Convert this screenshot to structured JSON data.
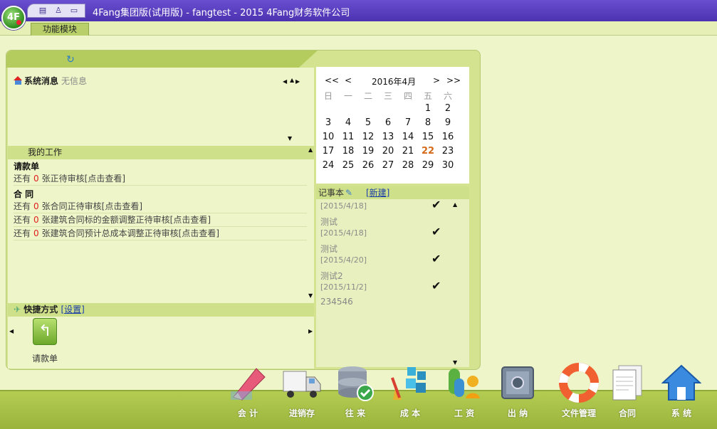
{
  "titlebar": {
    "logo_text": "4F",
    "title": "4Fang集团版(试用版) - fangtest - 2015 4Fang财务软件公司",
    "quick_icons": [
      "book-icon",
      "user-icon",
      "chat-icon"
    ]
  },
  "tabs": [
    {
      "label": "功能模块"
    }
  ],
  "messages": {
    "title": "系统消息",
    "empty_text": "无信息"
  },
  "work": {
    "section_title": "我的工作",
    "prefix": "还有",
    "groups": [
      {
        "heading": "请款单",
        "items": [
          {
            "count": "0",
            "text": "张正待审核[点击查看]"
          }
        ]
      },
      {
        "heading": "合 同",
        "items": [
          {
            "count": "0",
            "text": "张合同正待审核[点击查看]"
          },
          {
            "count": "0",
            "text": "张建筑合同标的金额调整正待审核[点击查看]"
          },
          {
            "count": "0",
            "text": "张建筑合同预计总成本调整正待审核[点击查看]"
          }
        ]
      }
    ]
  },
  "shortcuts": {
    "title": "快捷方式",
    "settings_label": "[设置]",
    "items": [
      {
        "label": "请款单"
      }
    ]
  },
  "calendar": {
    "prev_year": "<<",
    "prev_month": "<",
    "month_label": "2016年4月",
    "next_month": ">",
    "next_year": ">>",
    "weekdays": [
      "日",
      "一",
      "二",
      "三",
      "四",
      "五",
      "六"
    ],
    "today": 22,
    "weeks": [
      [
        "",
        "",
        "",
        "",
        "",
        "1",
        "2"
      ],
      [
        "3",
        "4",
        "5",
        "6",
        "7",
        "8",
        "9"
      ],
      [
        "10",
        "11",
        "12",
        "13",
        "14",
        "15",
        "16"
      ],
      [
        "17",
        "18",
        "19",
        "20",
        "21",
        "22",
        "23"
      ],
      [
        "24",
        "25",
        "26",
        "27",
        "28",
        "29",
        "30"
      ]
    ]
  },
  "notes": {
    "title": "记事本",
    "new_label": "[新建]",
    "entries": [
      {
        "text": "",
        "date": "[2015/4/18]",
        "done": true
      },
      {
        "text": "测试",
        "date": "[2015/4/18]",
        "done": true
      },
      {
        "text": "测试",
        "date": "[2015/4/20]",
        "done": true
      },
      {
        "text": "测试2",
        "date": "[2015/11/2]",
        "done": true
      },
      {
        "text": "234546",
        "date": "",
        "done": false
      }
    ]
  },
  "toolbar": [
    {
      "label": "会 计",
      "icon": "pencil-icon"
    },
    {
      "label": "进销存",
      "icon": "truck-icon"
    },
    {
      "label": "往 来",
      "icon": "database-icon"
    },
    {
      "label": "成 本",
      "icon": "cubes-icon"
    },
    {
      "label": "工 资",
      "icon": "money-icon"
    },
    {
      "label": "出 纳",
      "icon": "safe-icon"
    },
    {
      "label": "文件管理",
      "icon": "lifebuoy-icon"
    },
    {
      "label": "合同",
      "icon": "documents-icon"
    },
    {
      "label": "系 统",
      "icon": "house-icon"
    }
  ],
  "colors": {
    "accent": "#4b32b0",
    "panel": "#d3e38f",
    "count": "#e02020",
    "today": "#d46a1a"
  }
}
